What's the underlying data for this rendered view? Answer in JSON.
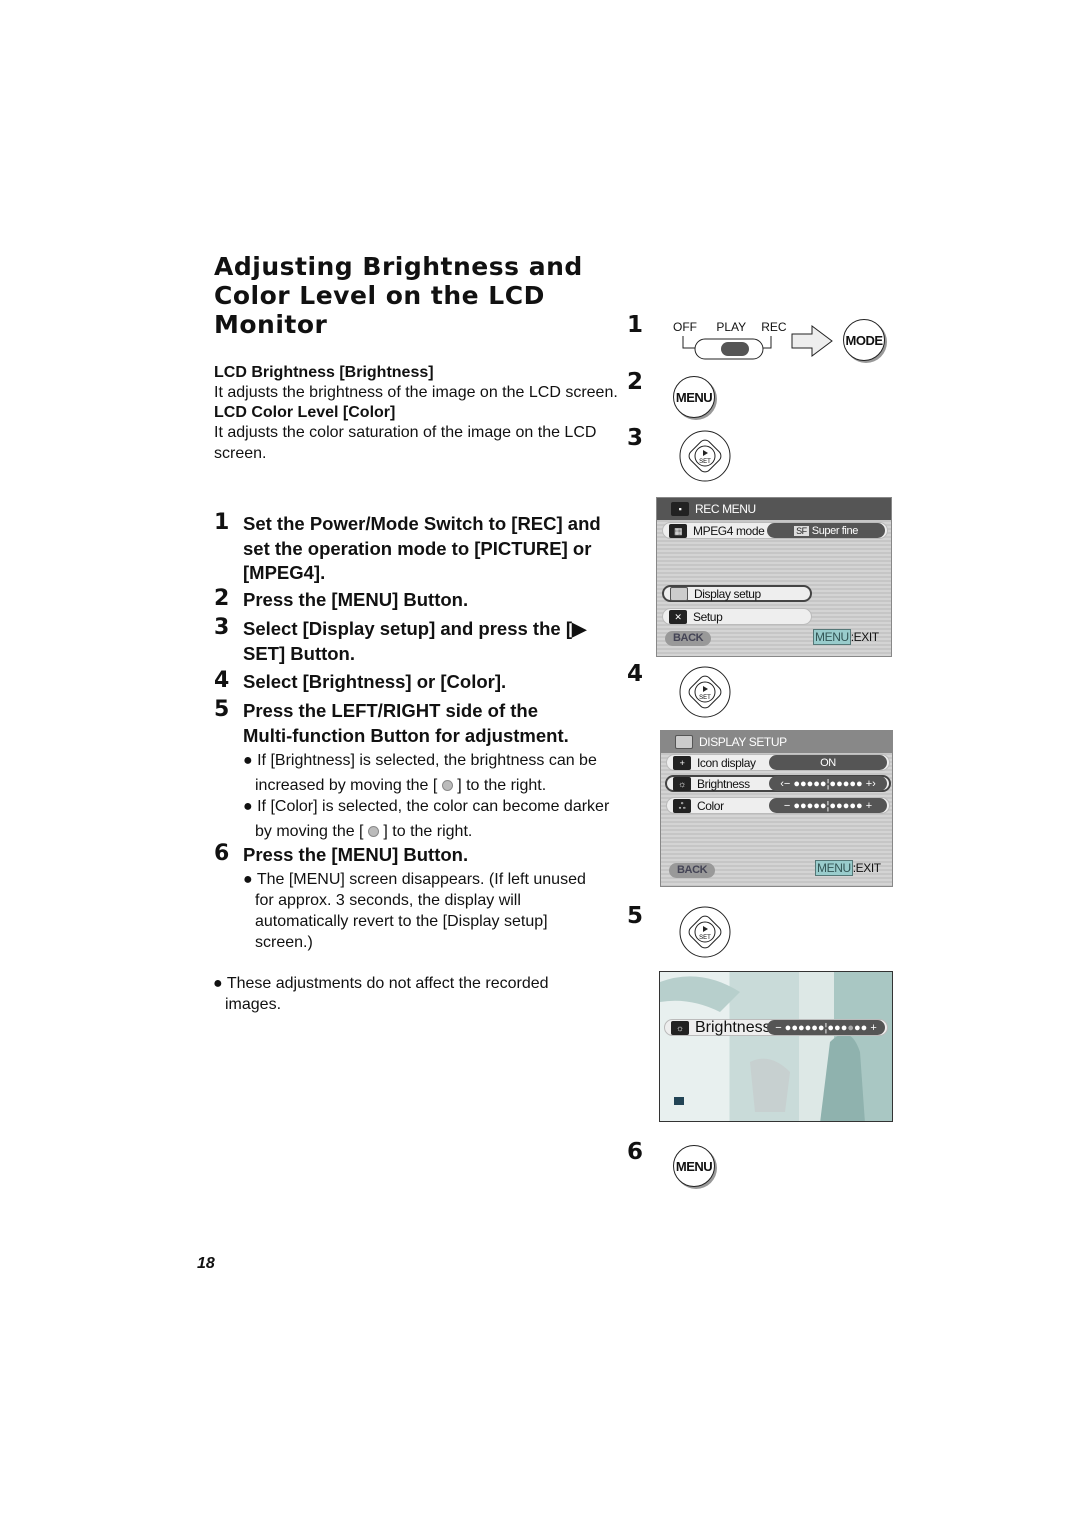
{
  "title": [
    "Adjusting Brightness and",
    "Color Level on the LCD",
    "Monitor"
  ],
  "intro": [
    {
      "heading": "LCD Brightness [Brightness]",
      "text": "It adjusts the brightness of the image on the LCD screen."
    },
    {
      "heading": "LCD Color Level [Color]",
      "text": "It adjusts the color saturation of the image on the LCD screen."
    }
  ],
  "steps": [
    {
      "num": "1",
      "text": "Set the Power/Mode Switch to [REC] and set the operation mode to [PICTURE] or [MPEG4]."
    },
    {
      "num": "2",
      "text": "Press the [MENU] Button."
    },
    {
      "num": "3",
      "text": "Select [Display setup] and press the [▶ SET] Button."
    },
    {
      "num": "4",
      "text": "Select [Brightness] or [Color]."
    },
    {
      "num": "5",
      "text": "Press the LEFT/RIGHT side of the Multi-function Button for adjustment."
    },
    {
      "num": "6",
      "text": "Press the [MENU] Button."
    }
  ],
  "step5_bullets": [
    {
      "pre": "If [Brightness] is selected, the brightness can be increased by moving the [ ",
      "post": " ] to the right."
    },
    {
      "pre": "If [Color] is selected, the color can become darker by moving the [ ",
      "post": " ] to the right."
    }
  ],
  "step6_bullet": "The [MENU] screen disappears. (If left unused for approx. 3 seconds, the display will automatically revert to the [Display setup] screen.)",
  "note": "These adjustments do not affect the recorded images.",
  "page_number": "18",
  "fig": {
    "switch_labels": [
      "OFF",
      "PLAY",
      "REC"
    ],
    "mode_label": "MODE",
    "menu_label": "MENU",
    "set_label": "SET",
    "rec_menu": {
      "title": "REC MENU",
      "mpeg4": "MPEG4 mode",
      "quality_badge": "SF",
      "quality": "Super fine",
      "display_setup": "Display setup",
      "setup": "Setup",
      "back": "BACK",
      "menu": "MENU",
      "exit": ":EXIT"
    },
    "display_setup": {
      "title": "DISPLAY SETUP",
      "icon_display": "Icon display",
      "icon_value": "ON",
      "brightness": "Brightness",
      "color": "Color",
      "brightness_level": 0,
      "color_level": 0,
      "back": "BACK",
      "menu": "MENU",
      "exit": ":EXIT"
    },
    "brightness_screen": {
      "label": "Brightness",
      "level": 2
    }
  }
}
